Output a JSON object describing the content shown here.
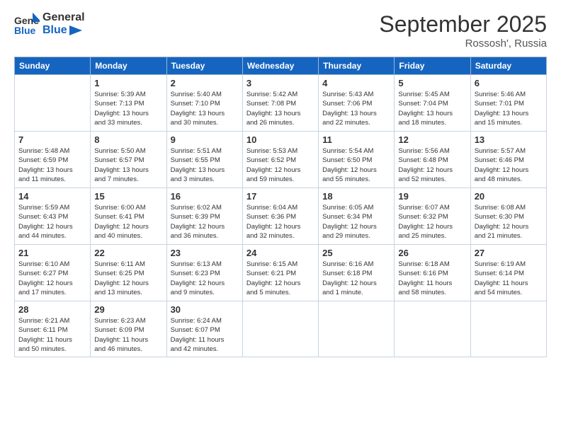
{
  "header": {
    "logo_general": "General",
    "logo_blue": "Blue",
    "month_title": "September 2025",
    "location": "Rossosh', Russia"
  },
  "weekdays": [
    "Sunday",
    "Monday",
    "Tuesday",
    "Wednesday",
    "Thursday",
    "Friday",
    "Saturday"
  ],
  "weeks": [
    [
      {
        "day": "",
        "info": ""
      },
      {
        "day": "1",
        "info": "Sunrise: 5:39 AM\nSunset: 7:13 PM\nDaylight: 13 hours\nand 33 minutes."
      },
      {
        "day": "2",
        "info": "Sunrise: 5:40 AM\nSunset: 7:10 PM\nDaylight: 13 hours\nand 30 minutes."
      },
      {
        "day": "3",
        "info": "Sunrise: 5:42 AM\nSunset: 7:08 PM\nDaylight: 13 hours\nand 26 minutes."
      },
      {
        "day": "4",
        "info": "Sunrise: 5:43 AM\nSunset: 7:06 PM\nDaylight: 13 hours\nand 22 minutes."
      },
      {
        "day": "5",
        "info": "Sunrise: 5:45 AM\nSunset: 7:04 PM\nDaylight: 13 hours\nand 18 minutes."
      },
      {
        "day": "6",
        "info": "Sunrise: 5:46 AM\nSunset: 7:01 PM\nDaylight: 13 hours\nand 15 minutes."
      }
    ],
    [
      {
        "day": "7",
        "info": "Sunrise: 5:48 AM\nSunset: 6:59 PM\nDaylight: 13 hours\nand 11 minutes."
      },
      {
        "day": "8",
        "info": "Sunrise: 5:50 AM\nSunset: 6:57 PM\nDaylight: 13 hours\nand 7 minutes."
      },
      {
        "day": "9",
        "info": "Sunrise: 5:51 AM\nSunset: 6:55 PM\nDaylight: 13 hours\nand 3 minutes."
      },
      {
        "day": "10",
        "info": "Sunrise: 5:53 AM\nSunset: 6:52 PM\nDaylight: 12 hours\nand 59 minutes."
      },
      {
        "day": "11",
        "info": "Sunrise: 5:54 AM\nSunset: 6:50 PM\nDaylight: 12 hours\nand 55 minutes."
      },
      {
        "day": "12",
        "info": "Sunrise: 5:56 AM\nSunset: 6:48 PM\nDaylight: 12 hours\nand 52 minutes."
      },
      {
        "day": "13",
        "info": "Sunrise: 5:57 AM\nSunset: 6:46 PM\nDaylight: 12 hours\nand 48 minutes."
      }
    ],
    [
      {
        "day": "14",
        "info": "Sunrise: 5:59 AM\nSunset: 6:43 PM\nDaylight: 12 hours\nand 44 minutes."
      },
      {
        "day": "15",
        "info": "Sunrise: 6:00 AM\nSunset: 6:41 PM\nDaylight: 12 hours\nand 40 minutes."
      },
      {
        "day": "16",
        "info": "Sunrise: 6:02 AM\nSunset: 6:39 PM\nDaylight: 12 hours\nand 36 minutes."
      },
      {
        "day": "17",
        "info": "Sunrise: 6:04 AM\nSunset: 6:36 PM\nDaylight: 12 hours\nand 32 minutes."
      },
      {
        "day": "18",
        "info": "Sunrise: 6:05 AM\nSunset: 6:34 PM\nDaylight: 12 hours\nand 29 minutes."
      },
      {
        "day": "19",
        "info": "Sunrise: 6:07 AM\nSunset: 6:32 PM\nDaylight: 12 hours\nand 25 minutes."
      },
      {
        "day": "20",
        "info": "Sunrise: 6:08 AM\nSunset: 6:30 PM\nDaylight: 12 hours\nand 21 minutes."
      }
    ],
    [
      {
        "day": "21",
        "info": "Sunrise: 6:10 AM\nSunset: 6:27 PM\nDaylight: 12 hours\nand 17 minutes."
      },
      {
        "day": "22",
        "info": "Sunrise: 6:11 AM\nSunset: 6:25 PM\nDaylight: 12 hours\nand 13 minutes."
      },
      {
        "day": "23",
        "info": "Sunrise: 6:13 AM\nSunset: 6:23 PM\nDaylight: 12 hours\nand 9 minutes."
      },
      {
        "day": "24",
        "info": "Sunrise: 6:15 AM\nSunset: 6:21 PM\nDaylight: 12 hours\nand 5 minutes."
      },
      {
        "day": "25",
        "info": "Sunrise: 6:16 AM\nSunset: 6:18 PM\nDaylight: 12 hours\nand 1 minute."
      },
      {
        "day": "26",
        "info": "Sunrise: 6:18 AM\nSunset: 6:16 PM\nDaylight: 11 hours\nand 58 minutes."
      },
      {
        "day": "27",
        "info": "Sunrise: 6:19 AM\nSunset: 6:14 PM\nDaylight: 11 hours\nand 54 minutes."
      }
    ],
    [
      {
        "day": "28",
        "info": "Sunrise: 6:21 AM\nSunset: 6:11 PM\nDaylight: 11 hours\nand 50 minutes."
      },
      {
        "day": "29",
        "info": "Sunrise: 6:23 AM\nSunset: 6:09 PM\nDaylight: 11 hours\nand 46 minutes."
      },
      {
        "day": "30",
        "info": "Sunrise: 6:24 AM\nSunset: 6:07 PM\nDaylight: 11 hours\nand 42 minutes."
      },
      {
        "day": "",
        "info": ""
      },
      {
        "day": "",
        "info": ""
      },
      {
        "day": "",
        "info": ""
      },
      {
        "day": "",
        "info": ""
      }
    ]
  ]
}
